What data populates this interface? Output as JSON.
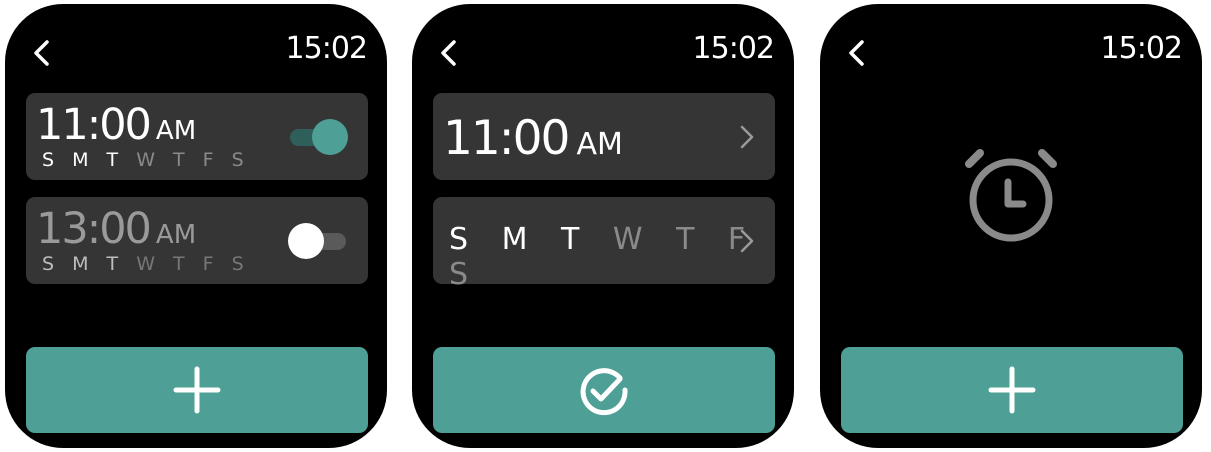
{
  "screens": [
    {
      "clock": "15:02",
      "alarms": [
        {
          "time": "11:00",
          "ampm": "AM",
          "days_active": "S M T",
          "days_inactive": "W T F S",
          "enabled": true
        },
        {
          "time": "13:00",
          "ampm": "AM",
          "days_active": "S M T",
          "days_inactive": "W T F S",
          "enabled": false
        }
      ],
      "action_icon": "plus-icon"
    },
    {
      "clock": "15:02",
      "time_row": {
        "time": "11:00",
        "ampm": "AM"
      },
      "days_row": {
        "days_active": "S M T",
        "days_inactive": "W T F S"
      },
      "action_icon": "check-circle-icon"
    },
    {
      "clock": "15:02",
      "empty_icon": "alarm-clock-icon",
      "action_icon": "plus-icon"
    }
  ],
  "colors": {
    "accent": "#4e9f95",
    "card": "#353535",
    "background": "#000000"
  }
}
